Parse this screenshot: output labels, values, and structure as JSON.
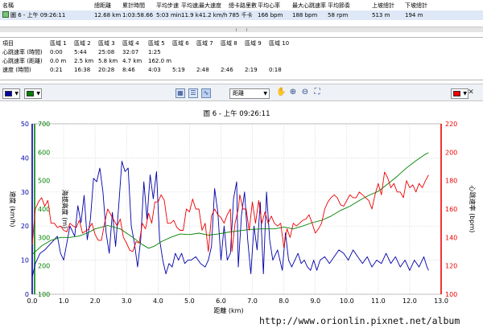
{
  "summary": {
    "headers": [
      "名稱",
      "總距離",
      "累計時間",
      "平均步速",
      "平均速度",
      "最大速度",
      "總卡路里數",
      "平均心率",
      "最大心跳速率",
      "平均節奏",
      "上坡總計",
      "下坡總計"
    ],
    "row": [
      "圖 6 - 上午 09:26:11",
      "12.68 km",
      "1:03:58.66",
      "5:03 min/km",
      "11.9 km/h",
      "41.2 km/h",
      "785 千卡",
      "166 bpm",
      "188 bpm",
      "58 rpm",
      "513 m",
      "194 m"
    ]
  },
  "zones": {
    "headers": [
      "項目",
      "區域 1",
      "區域 2",
      "區域 3",
      "區域 4",
      "區域 5",
      "區域 6",
      "區域 7",
      "區域 8",
      "區域 9",
      "區域 10"
    ],
    "rows": [
      [
        "心跳速率 (時間)",
        "0:00",
        "5:44",
        "25:08",
        "32:07",
        "1:25",
        "",
        "",
        "",
        "",
        ""
      ],
      [
        "心跳速率 (距離)",
        "0.0 m",
        "2.5 km",
        "5.8 km",
        "4.7 km",
        "162.0 m",
        "",
        "",
        "",
        "",
        ""
      ],
      [
        "速度 (時間)",
        "0:21",
        "16:38",
        "20:28",
        "8:46",
        "4:03",
        "5:19",
        "2:48",
        "2:46",
        "2:19",
        "0:18"
      ]
    ]
  },
  "toolbar": {
    "left_color": "#0000aa",
    "middle_color": "#008000",
    "right_color": "#ee0000",
    "x_axis_option": "距離",
    "icons": [
      "table-view-icon",
      "split-view-icon",
      "chart-view-icon",
      "hand-pan-icon",
      "zoom-in-icon",
      "zoom-out-icon",
      "zoom-fit-icon",
      "close-icon"
    ]
  },
  "chart_data": {
    "type": "line",
    "title": "圖 6 - 上午 09:26:11",
    "xlabel": "距離 (km)",
    "xlim": [
      0,
      13
    ],
    "x_ticks": [
      0.0,
      1.0,
      2.0,
      3.0,
      4.0,
      5.0,
      6.0,
      7.0,
      8.0,
      9.0,
      10.0,
      11.0,
      12.0,
      13.0
    ],
    "grid": true,
    "axes": [
      {
        "side": "left",
        "label": "速度 (km/h)",
        "color": "#0000aa",
        "range": [
          0,
          50
        ],
        "ticks": [
          0,
          10,
          20,
          30,
          40,
          50
        ]
      },
      {
        "side": "left-inner",
        "label": "海拔高度 (m)",
        "color": "#008000",
        "range": [
          100,
          700
        ],
        "ticks": [
          100,
          200,
          300,
          400,
          500,
          600,
          700
        ]
      },
      {
        "side": "right",
        "label": "心跳速率 (bpm)",
        "color": "#ee0000",
        "range": [
          100,
          220
        ],
        "ticks": [
          100,
          120,
          140,
          160,
          180,
          200,
          220
        ]
      }
    ],
    "series": [
      {
        "axis": 0,
        "color": "#0000aa",
        "points": [
          [
            0,
            5
          ],
          [
            0.1,
            9
          ],
          [
            0.25,
            12
          ],
          [
            0.4,
            13
          ],
          [
            0.6,
            15
          ],
          [
            0.8,
            17
          ],
          [
            0.9,
            12
          ],
          [
            1.0,
            10
          ],
          [
            1.1,
            15
          ],
          [
            1.2,
            20
          ],
          [
            1.35,
            17
          ],
          [
            1.45,
            26
          ],
          [
            1.55,
            21
          ],
          [
            1.65,
            29
          ],
          [
            1.75,
            16
          ],
          [
            1.85,
            22
          ],
          [
            1.95,
            34
          ],
          [
            2.05,
            33
          ],
          [
            2.15,
            37
          ],
          [
            2.25,
            30
          ],
          [
            2.35,
            18
          ],
          [
            2.45,
            12
          ],
          [
            2.55,
            24
          ],
          [
            2.65,
            14
          ],
          [
            2.75,
            26
          ],
          [
            2.85,
            39
          ],
          [
            2.95,
            36
          ],
          [
            3.05,
            37
          ],
          [
            3.15,
            20
          ],
          [
            3.25,
            15
          ],
          [
            3.35,
            8
          ],
          [
            3.45,
            16
          ],
          [
            3.55,
            33
          ],
          [
            3.65,
            22
          ],
          [
            3.75,
            35
          ],
          [
            3.85,
            28
          ],
          [
            3.95,
            36
          ],
          [
            4.05,
            16
          ],
          [
            4.15,
            10
          ],
          [
            4.25,
            6
          ],
          [
            4.35,
            9
          ],
          [
            4.45,
            8
          ],
          [
            4.55,
            12
          ],
          [
            4.65,
            10
          ],
          [
            4.75,
            12
          ],
          [
            4.85,
            9
          ],
          [
            4.95,
            10
          ],
          [
            5.05,
            10
          ],
          [
            5.2,
            11
          ],
          [
            5.35,
            9
          ],
          [
            5.5,
            8
          ],
          [
            5.6,
            10
          ],
          [
            5.7,
            14
          ],
          [
            5.8,
            31
          ],
          [
            5.9,
            24
          ],
          [
            6.0,
            10
          ],
          [
            6.1,
            20
          ],
          [
            6.2,
            10
          ],
          [
            6.3,
            12
          ],
          [
            6.4,
            28
          ],
          [
            6.5,
            33
          ],
          [
            6.55,
            8
          ],
          [
            6.65,
            23
          ],
          [
            6.75,
            30
          ],
          [
            6.85,
            16
          ],
          [
            6.95,
            6
          ],
          [
            7.05,
            20
          ],
          [
            7.15,
            13
          ],
          [
            7.25,
            27
          ],
          [
            7.35,
            6
          ],
          [
            7.45,
            30
          ],
          [
            7.55,
            16
          ],
          [
            7.65,
            10
          ],
          [
            7.8,
            13
          ],
          [
            7.95,
            7
          ],
          [
            8.05,
            18
          ],
          [
            8.15,
            10
          ],
          [
            8.25,
            8
          ],
          [
            8.35,
            10
          ],
          [
            8.45,
            12
          ],
          [
            8.55,
            9
          ],
          [
            8.65,
            10
          ],
          [
            8.75,
            8
          ],
          [
            8.85,
            7
          ],
          [
            8.95,
            10
          ],
          [
            9.05,
            7
          ],
          [
            9.15,
            10
          ],
          [
            9.3,
            11
          ],
          [
            9.45,
            9
          ],
          [
            9.6,
            11
          ],
          [
            9.75,
            13
          ],
          [
            9.9,
            12
          ],
          [
            10.05,
            10
          ],
          [
            10.2,
            13
          ],
          [
            10.35,
            11
          ],
          [
            10.5,
            9
          ],
          [
            10.65,
            11
          ],
          [
            10.8,
            8
          ],
          [
            10.95,
            10
          ],
          [
            11.1,
            9
          ],
          [
            11.25,
            12
          ],
          [
            11.4,
            9
          ],
          [
            11.55,
            11
          ],
          [
            11.7,
            8
          ],
          [
            11.85,
            10
          ],
          [
            12.0,
            7
          ],
          [
            12.15,
            10
          ],
          [
            12.3,
            8
          ],
          [
            12.45,
            11
          ],
          [
            12.55,
            8
          ],
          [
            12.6,
            7
          ]
        ]
      },
      {
        "axis": 1,
        "color": "#008000",
        "points": [
          [
            0,
            240
          ],
          [
            0.3,
            270
          ],
          [
            0.6,
            290
          ],
          [
            0.9,
            300
          ],
          [
            1.2,
            300
          ],
          [
            1.5,
            305
          ],
          [
            1.8,
            318
          ],
          [
            2.0,
            330
          ],
          [
            2.4,
            342
          ],
          [
            2.8,
            330
          ],
          [
            3.2,
            300
          ],
          [
            3.5,
            275
          ],
          [
            3.7,
            262
          ],
          [
            3.9,
            270
          ],
          [
            4.1,
            285
          ],
          [
            4.4,
            300
          ],
          [
            4.7,
            312
          ],
          [
            5.0,
            310
          ],
          [
            5.3,
            315
          ],
          [
            5.6,
            308
          ],
          [
            5.9,
            312
          ],
          [
            6.2,
            318
          ],
          [
            6.5,
            322
          ],
          [
            6.9,
            328
          ],
          [
            7.3,
            330
          ],
          [
            7.7,
            330
          ],
          [
            8.0,
            336
          ],
          [
            8.3,
            330
          ],
          [
            8.6,
            340
          ],
          [
            8.9,
            352
          ],
          [
            9.2,
            360
          ],
          [
            9.5,
            375
          ],
          [
            9.8,
            395
          ],
          [
            10.1,
            410
          ],
          [
            10.4,
            430
          ],
          [
            10.7,
            448
          ],
          [
            11.0,
            462
          ],
          [
            11.3,
            488
          ],
          [
            11.6,
            515
          ],
          [
            11.9,
            545
          ],
          [
            12.2,
            570
          ],
          [
            12.5,
            593
          ],
          [
            12.6,
            598
          ]
        ]
      },
      {
        "axis": 2,
        "color": "#ee0000",
        "points": [
          [
            0,
            135
          ],
          [
            0.1,
            160
          ],
          [
            0.2,
            165
          ],
          [
            0.3,
            168
          ],
          [
            0.4,
            162
          ],
          [
            0.5,
            166
          ],
          [
            0.6,
            150
          ],
          [
            0.7,
            150
          ],
          [
            0.8,
            147
          ],
          [
            0.9,
            148
          ],
          [
            1.0,
            145
          ],
          [
            1.1,
            144
          ],
          [
            1.2,
            150
          ],
          [
            1.3,
            148
          ],
          [
            1.4,
            147
          ],
          [
            1.5,
            152
          ],
          [
            1.6,
            143
          ],
          [
            1.8,
            146
          ],
          [
            1.9,
            150
          ],
          [
            2.0,
            142
          ],
          [
            2.1,
            138
          ],
          [
            2.2,
            138
          ],
          [
            2.3,
            150
          ],
          [
            2.4,
            160
          ],
          [
            2.5,
            156
          ],
          [
            2.6,
            152
          ],
          [
            2.7,
            148
          ],
          [
            2.8,
            153
          ],
          [
            2.9,
            140
          ],
          [
            3.0,
            136
          ],
          [
            3.1,
            131
          ],
          [
            3.2,
            130
          ],
          [
            3.3,
            137
          ],
          [
            3.4,
            136
          ],
          [
            3.5,
            150
          ],
          [
            3.6,
            146
          ],
          [
            3.7,
            157
          ],
          [
            3.8,
            150
          ],
          [
            3.9,
            165
          ],
          [
            4.0,
            165
          ],
          [
            4.1,
            170
          ],
          [
            4.2,
            166
          ],
          [
            4.3,
            150
          ],
          [
            4.4,
            150
          ],
          [
            4.5,
            152
          ],
          [
            4.6,
            147
          ],
          [
            4.7,
            145
          ],
          [
            4.8,
            145
          ],
          [
            4.9,
            160
          ],
          [
            5.0,
            158
          ],
          [
            5.1,
            167
          ],
          [
            5.2,
            160
          ],
          [
            5.3,
            160
          ],
          [
            5.4,
            145
          ],
          [
            5.5,
            150
          ],
          [
            5.6,
            130
          ],
          [
            5.7,
            155
          ],
          [
            5.8,
            160
          ],
          [
            5.9,
            156
          ],
          [
            6.0,
            154
          ],
          [
            6.1,
            150
          ],
          [
            6.2,
            156
          ],
          [
            6.3,
            160
          ],
          [
            6.35,
            130
          ],
          [
            6.45,
            150
          ],
          [
            6.55,
            160
          ],
          [
            6.6,
            170
          ],
          [
            6.7,
            160
          ],
          [
            6.8,
            160
          ],
          [
            6.9,
            145
          ],
          [
            7.0,
            165
          ],
          [
            7.1,
            150
          ],
          [
            7.2,
            166
          ],
          [
            7.3,
            150
          ],
          [
            7.4,
            158
          ],
          [
            7.5,
            150
          ],
          [
            7.6,
            155
          ],
          [
            7.7,
            150
          ],
          [
            7.8,
            148
          ],
          [
            7.9,
            150
          ],
          [
            8.0,
            133
          ],
          [
            8.1,
            146
          ],
          [
            8.2,
            140
          ],
          [
            8.3,
            150
          ],
          [
            8.4,
            148
          ],
          [
            8.5,
            150
          ],
          [
            8.6,
            152
          ],
          [
            8.7,
            153
          ],
          [
            8.8,
            156
          ],
          [
            8.9,
            150
          ],
          [
            9.0,
            143
          ],
          [
            9.1,
            146
          ],
          [
            9.2,
            150
          ],
          [
            9.3,
            160
          ],
          [
            9.4,
            165
          ],
          [
            9.5,
            168
          ],
          [
            9.6,
            170
          ],
          [
            9.7,
            168
          ],
          [
            9.8,
            163
          ],
          [
            9.9,
            162
          ],
          [
            10.0,
            166
          ],
          [
            10.1,
            170
          ],
          [
            10.2,
            168
          ],
          [
            10.3,
            168
          ],
          [
            10.4,
            172
          ],
          [
            10.5,
            170
          ],
          [
            10.6,
            168
          ],
          [
            10.7,
            166
          ],
          [
            10.8,
            160
          ],
          [
            10.9,
            170
          ],
          [
            11.0,
            178
          ],
          [
            11.1,
            170
          ],
          [
            11.2,
            186
          ],
          [
            11.3,
            182
          ],
          [
            11.4,
            175
          ],
          [
            11.5,
            178
          ],
          [
            11.6,
            172
          ],
          [
            11.7,
            172
          ],
          [
            11.8,
            168
          ],
          [
            11.9,
            180
          ],
          [
            12.0,
            175
          ],
          [
            12.1,
            177
          ],
          [
            12.2,
            172
          ],
          [
            12.3,
            178
          ],
          [
            12.4,
            175
          ],
          [
            12.5,
            180
          ],
          [
            12.6,
            184
          ]
        ]
      }
    ]
  },
  "watermark": "http://www.orionlin.pixnet.net/album"
}
